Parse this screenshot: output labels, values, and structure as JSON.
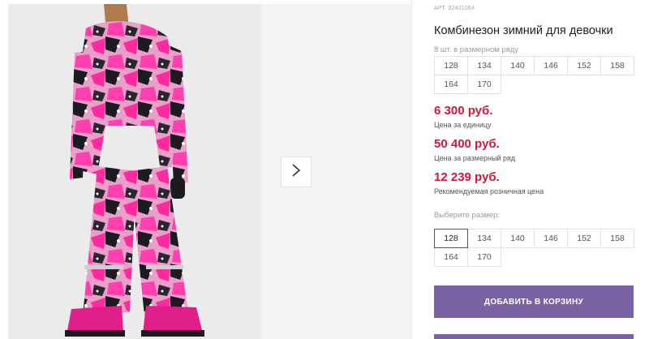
{
  "product": {
    "sku": "АРТ. 32421064",
    "title": "Комбинезон зимний для девочки",
    "size_row_note": "8 шт. в размерном ряду",
    "size_row": [
      "128",
      "134",
      "140",
      "146",
      "152",
      "158",
      "164",
      "170"
    ]
  },
  "prices": {
    "unit_price": "6 300 руб.",
    "unit_label": "Цена за единицу",
    "row_price": "50 400 руб.",
    "row_label": "Цена за размерный ряд",
    "retail_price": "12 239 руб.",
    "retail_label": "Рекомендуемая розничная цена"
  },
  "size_select": {
    "label": "Выберите размер:",
    "options": [
      "128",
      "134",
      "140",
      "146",
      "152",
      "158",
      "164",
      "170"
    ],
    "selected": "128"
  },
  "actions": {
    "add_to_cart": "ДОБАВИТЬ В КОРЗИНУ"
  },
  "colors": {
    "price": "#d3163b",
    "button": "#7b62a3"
  }
}
